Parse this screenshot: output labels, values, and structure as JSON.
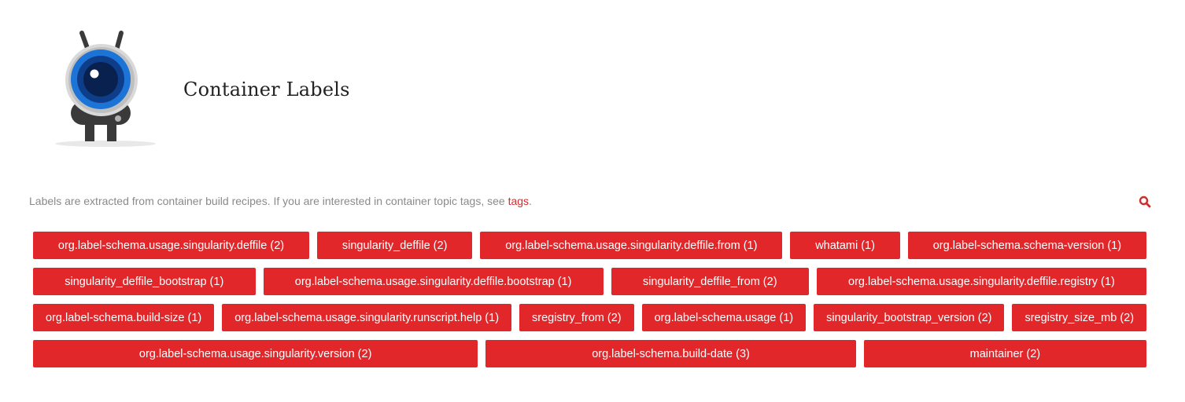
{
  "header": {
    "title": "Container Labels"
  },
  "intro": {
    "text": "Labels are extracted from container build recipes. If you are interested in container topic tags, see ",
    "link_text": "tags",
    "suffix": "."
  },
  "icons": {
    "search": "search-icon",
    "logo": "sregistry-robot-logo"
  },
  "colors": {
    "accent": "#e2272b",
    "link": "#d32a2a"
  },
  "label_rows": [
    [
      {
        "label": "org.label-schema.usage.singularity.deffile (2)"
      },
      {
        "label": "singularity_deffile (2)"
      },
      {
        "label": "org.label-schema.usage.singularity.deffile.from (1)"
      },
      {
        "label": "whatami (1)"
      },
      {
        "label": "org.label-schema.schema-version (1)"
      }
    ],
    [
      {
        "label": "singularity_deffile_bootstrap (1)"
      },
      {
        "label": "org.label-schema.usage.singularity.deffile.bootstrap (1)"
      },
      {
        "label": "singularity_deffile_from (2)"
      },
      {
        "label": "org.label-schema.usage.singularity.deffile.registry (1)"
      }
    ],
    [
      {
        "label": "org.label-schema.build-size (1)"
      },
      {
        "label": "org.label-schema.usage.singularity.runscript.help (1)"
      },
      {
        "label": "sregistry_from (2)"
      },
      {
        "label": "org.label-schema.usage (1)"
      },
      {
        "label": "singularity_bootstrap_version (2)"
      },
      {
        "label": "sregistry_size_mb (2)"
      }
    ],
    [
      {
        "label": "org.label-schema.usage.singularity.version (2)"
      },
      {
        "label": "org.label-schema.build-date (3)"
      },
      {
        "label": "maintainer (2)"
      }
    ]
  ]
}
